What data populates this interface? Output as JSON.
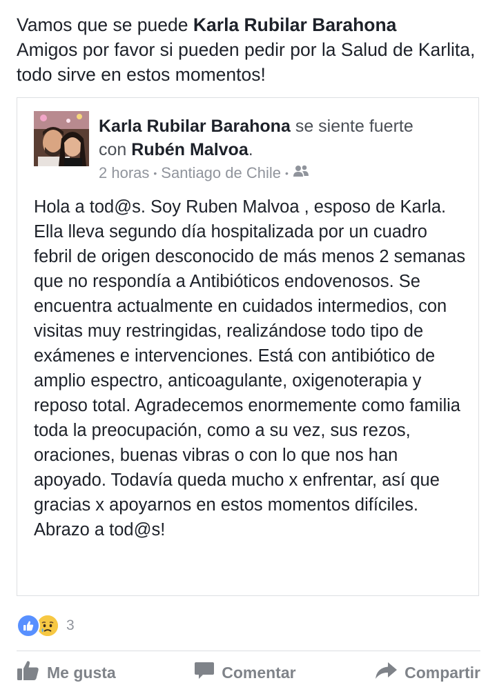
{
  "post": {
    "intro_prefix": "Vamos que se puede",
    "tagged_name": "Karla Rubilar Barahona",
    "intro_line2": "Amigos por favor si pueden pedir por la Salud de Karlita, todo sirve en estos momentos!"
  },
  "shared": {
    "author": "Karla Rubilar Barahona",
    "feeling": "se siente fuerte",
    "with_label": "con",
    "with_name": "Rubén Malvoa",
    "period": ".",
    "time": "2 horas",
    "separator": "•",
    "location": "Santiago de Chile",
    "privacy_icon": "friends-icon",
    "body": "Hola a tod@s. Soy Ruben Malvoa , esposo de Karla. Ella lleva segundo día hospitalizada por un cuadro febril de origen desconocido de más menos 2 semanas que no respondía a Antibióticos endovenosos. Se encuentra actualmente en cuidados intermedios, con visitas muy restringidas, realizándose todo tipo de exámenes e intervenciones. Está con antibiótico de amplio espectro, anticoagulante, oxigenoterapia y reposo total. Agradecemos enormemente como familia toda la preocupación, como a su vez, sus rezos, oraciones, buenas vibras o con lo que nos han apoyado. Todavía queda mucho x enfrentar, así que gracias x apoyarnos en estos momentos difíciles. Abrazo a tod@s!"
  },
  "reactions": {
    "icons": [
      "like-reaction-icon",
      "sad-reaction-icon"
    ],
    "count": "3"
  },
  "actions": {
    "like": "Me gusta",
    "comment": "Comentar",
    "share": "Compartir"
  },
  "colors": {
    "text": "#1d2129",
    "secondary": "#90949c",
    "like_blue": "#5890ff",
    "sad_yellow": "#f7c843",
    "border": "#dddfe2"
  }
}
